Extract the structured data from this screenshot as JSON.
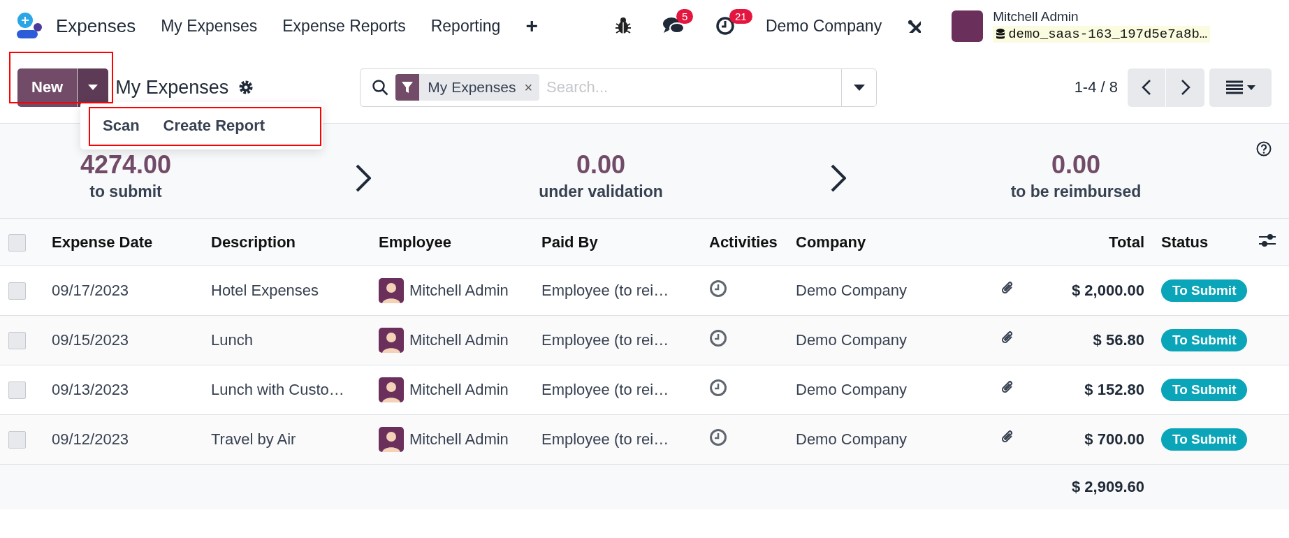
{
  "navbar": {
    "app_name": "Expenses",
    "menu": [
      "My Expenses",
      "Expense Reports",
      "Reporting"
    ],
    "add_symbol": "+",
    "messages_badge": "5",
    "activities_badge": "21",
    "company": "Demo Company",
    "user": {
      "name": "Mitchell Admin",
      "database": "demo_saas-163_197d5e7a8b…"
    }
  },
  "control_panel": {
    "new_button": "New",
    "dropdown_items": [
      "Scan",
      "Create Report"
    ],
    "title": "My Expenses",
    "search": {
      "facet": "My Expenses",
      "facet_remove": "×",
      "placeholder": "Search..."
    },
    "pager": "1-4 / 8"
  },
  "summary": [
    {
      "amount": "4274.00",
      "label": "to submit"
    },
    {
      "amount": "0.00",
      "label": "under validation"
    },
    {
      "amount": "0.00",
      "label": "to be reimbursed"
    }
  ],
  "table": {
    "select_all": {
      "checked": false
    },
    "columns": [
      "Expense Date",
      "Description",
      "Employee",
      "Paid By",
      "Activities",
      "Company",
      "Total",
      "Status"
    ],
    "rows": [
      {
        "checked": false,
        "date": "09/17/2023",
        "description": "Hotel Expenses",
        "employee": "Mitchell Admin",
        "paid_by": "Employee (to rei…",
        "company": "Demo Company",
        "total": "$ 2,000.00",
        "status": "To Submit"
      },
      {
        "checked": false,
        "date": "09/15/2023",
        "description": "Lunch",
        "employee": "Mitchell Admin",
        "paid_by": "Employee (to rei…",
        "company": "Demo Company",
        "total": "$ 56.80",
        "status": "To Submit"
      },
      {
        "checked": false,
        "date": "09/13/2023",
        "description": "Lunch with Custo…",
        "employee": "Mitchell Admin",
        "paid_by": "Employee (to rei…",
        "company": "Demo Company",
        "total": "$ 152.80",
        "status": "To Submit"
      },
      {
        "checked": false,
        "date": "09/12/2023",
        "description": "Travel by Air",
        "employee": "Mitchell Admin",
        "paid_by": "Employee (to rei…",
        "company": "Demo Company",
        "total": "$ 700.00",
        "status": "To Submit"
      }
    ],
    "grand_total": "$ 2,909.60"
  }
}
